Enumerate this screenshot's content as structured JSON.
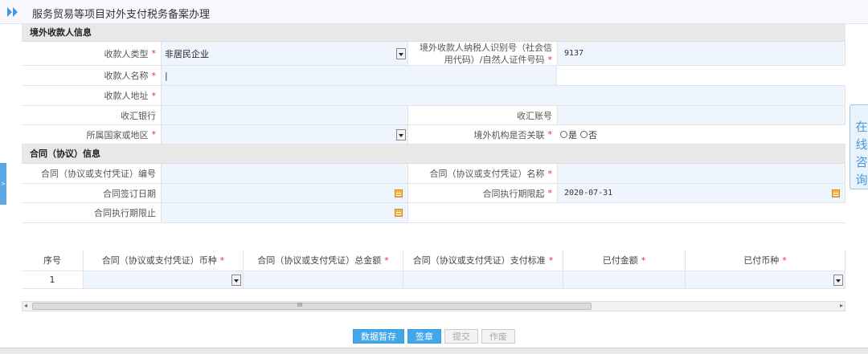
{
  "page": {
    "title": "服务贸易等项目对外支付税务备案办理"
  },
  "sections": {
    "payee": "境外收款人信息",
    "contract": "合同（协议）信息"
  },
  "payee": {
    "type_label": "收款人类型",
    "type_value": "非居民企业",
    "taxid_label_line1": "境外收款人纳税人识别号（社会信",
    "taxid_label_line2": "用代码）/自然人证件号码",
    "taxid_value": "9137",
    "name_label": "收款人名称",
    "name_value": "|",
    "address_label": "收款人地址",
    "bank_label": "收汇银行",
    "account_label": "收汇账号",
    "country_label": "所属国家或地区",
    "related_label": "境外机构是否关联",
    "related_yes": "是",
    "related_no": "否"
  },
  "contract": {
    "number_label": "合同（协议或支付凭证）编号",
    "name_label": "合同（协议或支付凭证）名称",
    "sign_date_label": "合同签订日期",
    "exec_start_label": "合同执行期限起",
    "exec_start_value": "2020-07-31",
    "exec_end_label": "合同执行期限止"
  },
  "table": {
    "headers": [
      "序号",
      "合同（协议或支付凭证）币种",
      "合同（协议或支付凭证）总金额",
      "合同（协议或支付凭证）支付标准",
      "已付金额",
      "已付币种"
    ],
    "required": [
      false,
      true,
      true,
      true,
      true,
      true
    ],
    "rows": [
      {
        "index": "1"
      }
    ]
  },
  "scrollbar": {
    "grip": "III"
  },
  "buttons": {
    "save": "数据暂存",
    "sign": "签章",
    "submit": "提交",
    "void": "作废"
  },
  "side": {
    "consult": [
      "在",
      "线",
      "咨",
      "询"
    ],
    "collapse_arrow": ">"
  },
  "colors": {
    "accent": "#42a7ea",
    "input_bg": "#eef5fd",
    "required": "#dd3333"
  }
}
